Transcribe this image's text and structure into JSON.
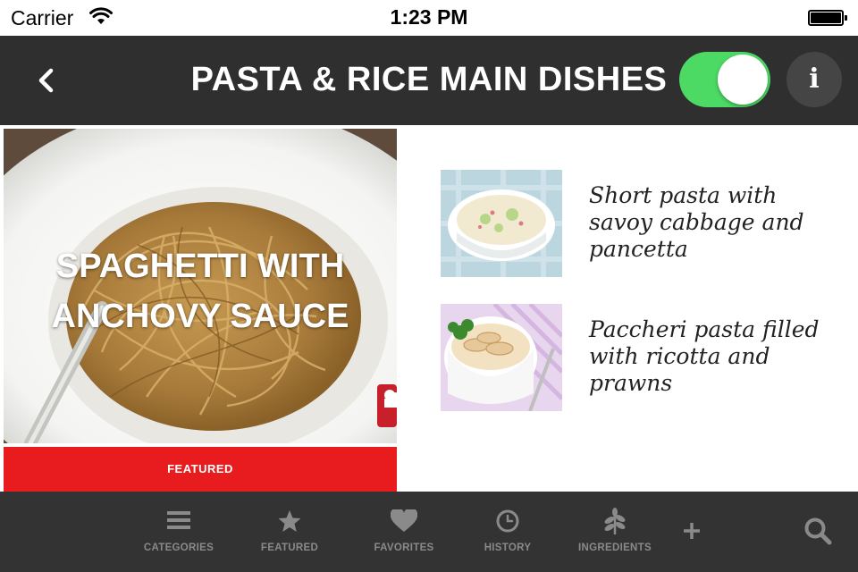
{
  "status_bar": {
    "carrier": "Carrier",
    "time": "1:23 PM"
  },
  "header": {
    "title": "PASTA & RICE MAIN DISHES",
    "toggle_on": true,
    "info_label": "i",
    "accent": "#4cd964"
  },
  "featured": {
    "title": "SPAGHETTI WITH ANCHOVY SAUCE",
    "label": "FEATURED",
    "label_color": "#e81c1f"
  },
  "recipes": [
    {
      "name": "Short pasta with savoy cabbage and pancetta"
    },
    {
      "name": "Paccheri pasta filled with ricotta and prawns"
    }
  ],
  "tabs": [
    {
      "label": "CATEGORIES",
      "icon": "list-icon"
    },
    {
      "label": "FEATURED",
      "icon": "star-icon"
    },
    {
      "label": "FAVORITES",
      "icon": "heart-icon"
    },
    {
      "label": "HISTORY",
      "icon": "clock-icon"
    },
    {
      "label": "INGREDIENTS",
      "icon": "herb-icon"
    }
  ],
  "tab_extras": {
    "add_icon": "plus-icon",
    "search_icon": "search-icon"
  }
}
